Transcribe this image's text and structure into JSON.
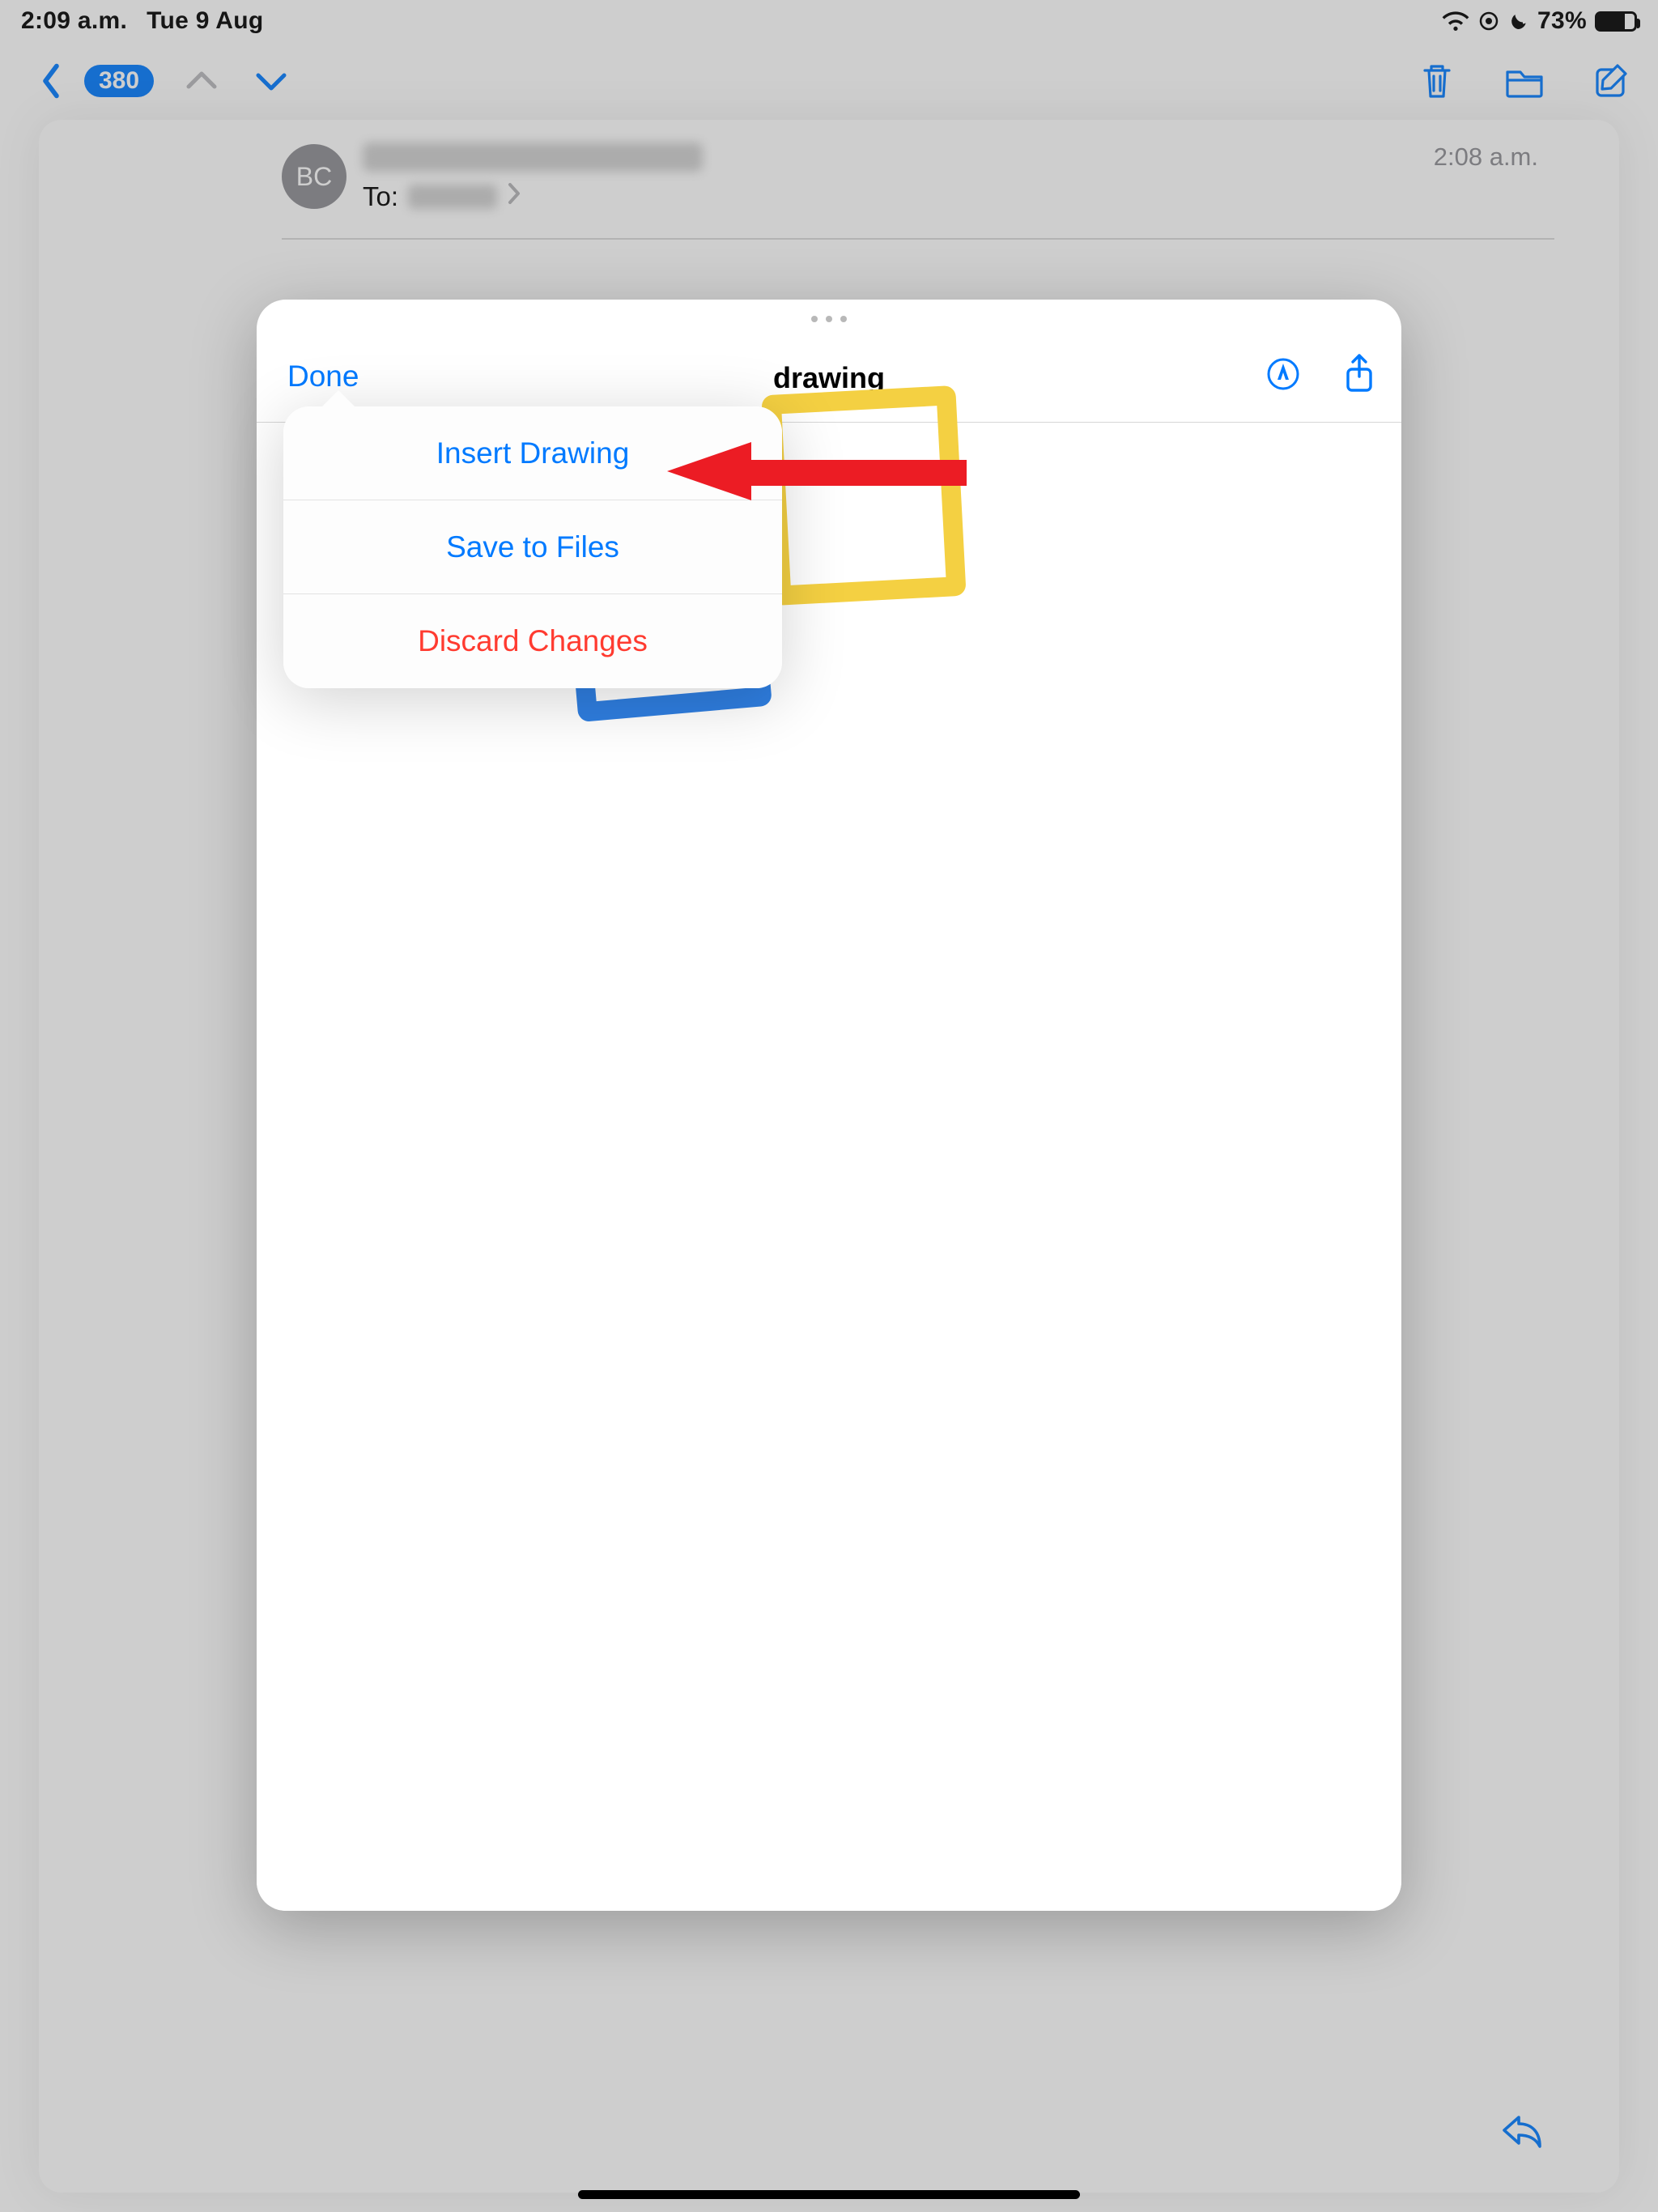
{
  "status": {
    "time": "2:09 a.m.",
    "date": "Tue 9 Aug",
    "battery_pct": "73%"
  },
  "nav": {
    "unread_badge": "380"
  },
  "message": {
    "avatar_initials": "BC",
    "received_time": "2:08 a.m.",
    "to_label": "To:"
  },
  "sheet": {
    "done_label": "Done",
    "title": "drawing"
  },
  "popover": {
    "insert": "Insert Drawing",
    "save": "Save to Files",
    "discard": "Discard Changes"
  }
}
